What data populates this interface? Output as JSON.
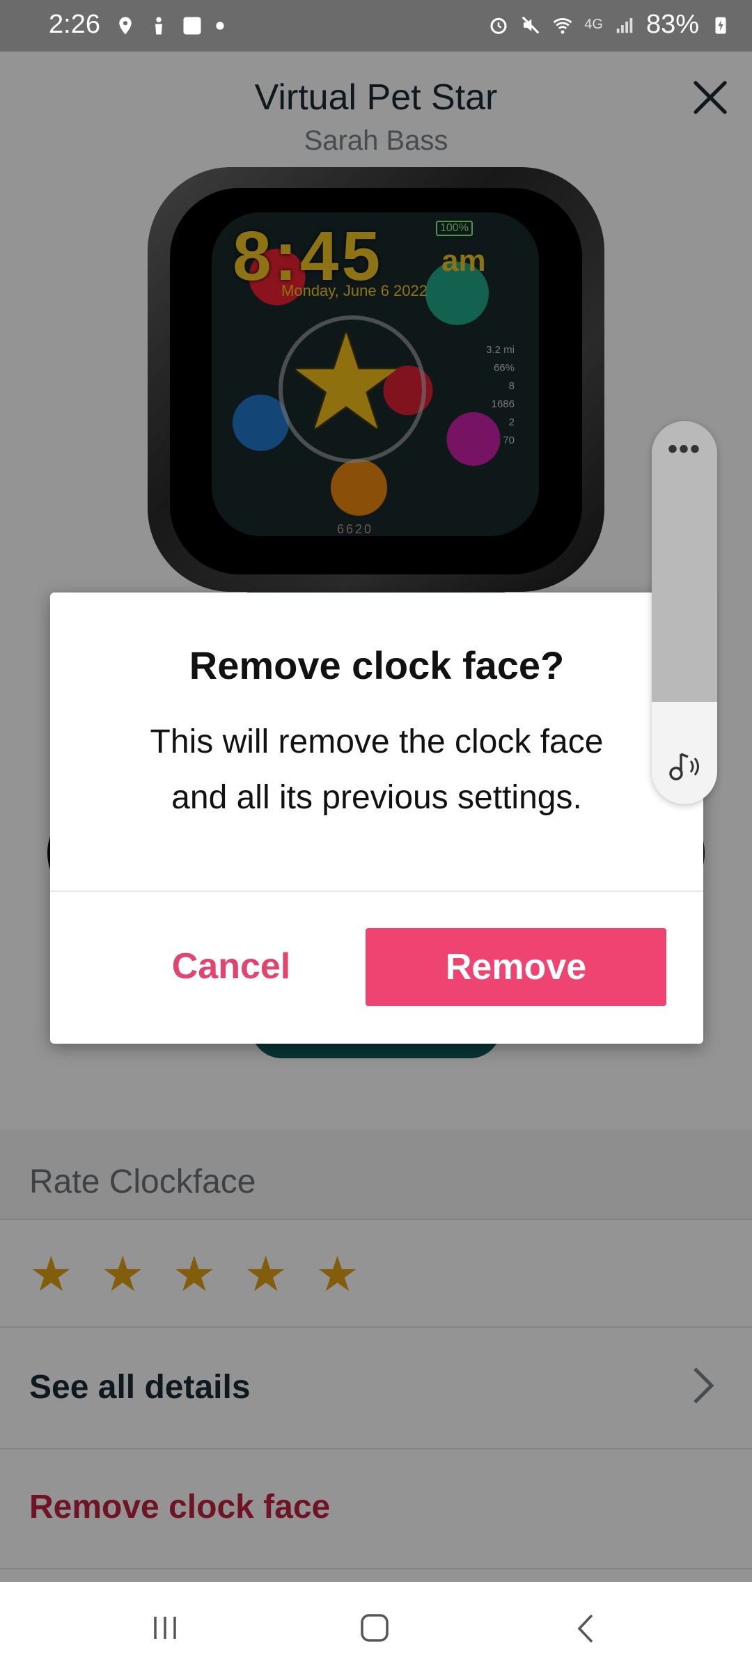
{
  "status_bar": {
    "time": "2:26",
    "battery": "83%",
    "network": "4G"
  },
  "header": {
    "title": "Virtual Pet Star",
    "subtitle": "Sarah Bass"
  },
  "watch_face": {
    "time": "8:45",
    "ampm": "am",
    "date": "Monday, June 6 2022",
    "battery": "100%",
    "stats": [
      "3.2 mi",
      "66%",
      "8",
      "1686",
      "2",
      "70"
    ],
    "steps": "6620"
  },
  "list": {
    "rate_label": "Rate Clockface",
    "rating_stars": 5,
    "details_label": "See all details",
    "remove_label": "Remove clock face"
  },
  "dialog": {
    "title": "Remove clock face?",
    "body_line1": "This will remove the clock face",
    "body_line2": "and all its previous settings.",
    "cancel_label": "Cancel",
    "remove_label": "Remove"
  },
  "volume_panel": {
    "more_label": "•••",
    "level": 0.73
  },
  "colors": {
    "accent": "#ef4471",
    "star": "#e0a113",
    "danger_text": "#c0243e"
  }
}
